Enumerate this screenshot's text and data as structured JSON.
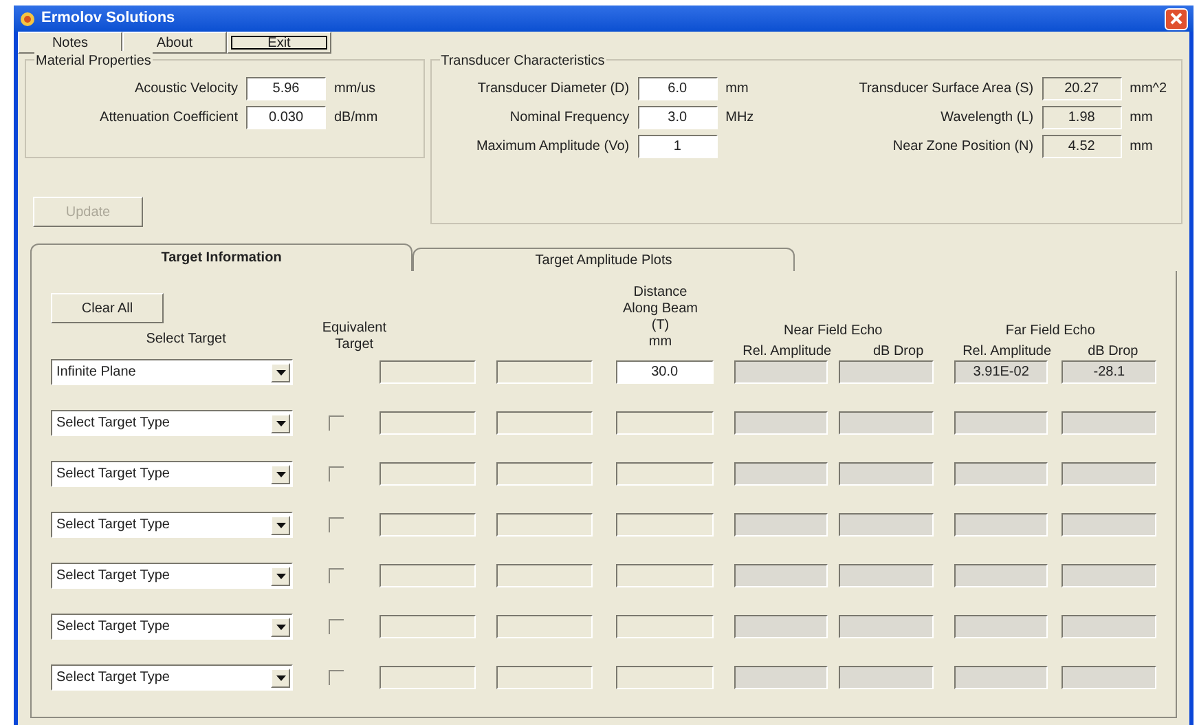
{
  "window": {
    "title": "Ermolov Solutions"
  },
  "menu": [
    "Notes",
    "About",
    "Exit"
  ],
  "material_properties": {
    "title": "Material Properties",
    "fields": [
      {
        "label": "Acoustic Velocity",
        "value": "5.96",
        "unit": "mm/us"
      },
      {
        "label": "Attenuation Coefficient",
        "value": "0.030",
        "unit": "dB/mm"
      }
    ]
  },
  "update_button": {
    "label": "Update",
    "disabled": true
  },
  "transducer": {
    "title": "Transducer Characteristics",
    "inputs": [
      {
        "label": "Transducer Diameter (D)",
        "value": "6.0",
        "unit": "mm"
      },
      {
        "label": "Nominal Frequency",
        "value": "3.0",
        "unit": "MHz"
      },
      {
        "label": "Maximum Amplitude (Vo)",
        "value": "1"
      }
    ],
    "outputs": [
      {
        "label": "Transducer Surface Area (S)",
        "value": "20.27",
        "unit": "mm^2"
      },
      {
        "label": "Wavelength (L)",
        "value": "1.98",
        "unit": "mm"
      },
      {
        "label": "Near Zone Position (N)",
        "value": "4.52",
        "unit": "mm"
      }
    ]
  },
  "tabs": [
    {
      "label": "Target Information",
      "selected": true
    },
    {
      "label": "Target Amplitude Plots",
      "selected": false
    }
  ],
  "clear_button": "Clear All",
  "headers": {
    "select": "Select Target",
    "equivalent": "Equivalent Target",
    "distance": [
      "Distance",
      "Along Beam",
      "(T)",
      "mm"
    ],
    "near_field": "Near Field Echo",
    "far_field": "Far Field Echo",
    "rel_amplitude": [
      "Rel. Amplitude",
      "Rel. Amplitude"
    ],
    "db_drop": [
      "dB Drop",
      "dB Drop"
    ]
  },
  "rows": [
    {
      "kind": "configured",
      "target": "Infinite Plane",
      "distance": "30.0",
      "far_rel_amplitude": "3.91E-02",
      "far_db_drop": "-28.1"
    },
    {
      "kind": "empty",
      "target": "Select Target Type",
      "equivalent_checked": false
    },
    {
      "kind": "empty",
      "target": "Select Target Type",
      "equivalent_checked": false
    },
    {
      "kind": "empty",
      "target": "Select Target Type",
      "equivalent_checked": false
    },
    {
      "kind": "empty",
      "target": "Select Target Type",
      "equivalent_checked": false
    },
    {
      "kind": "empty",
      "target": "Select Target Type",
      "equivalent_checked": false
    },
    {
      "kind": "empty",
      "target": "Select Target Type",
      "equivalent_checked": false
    }
  ]
}
